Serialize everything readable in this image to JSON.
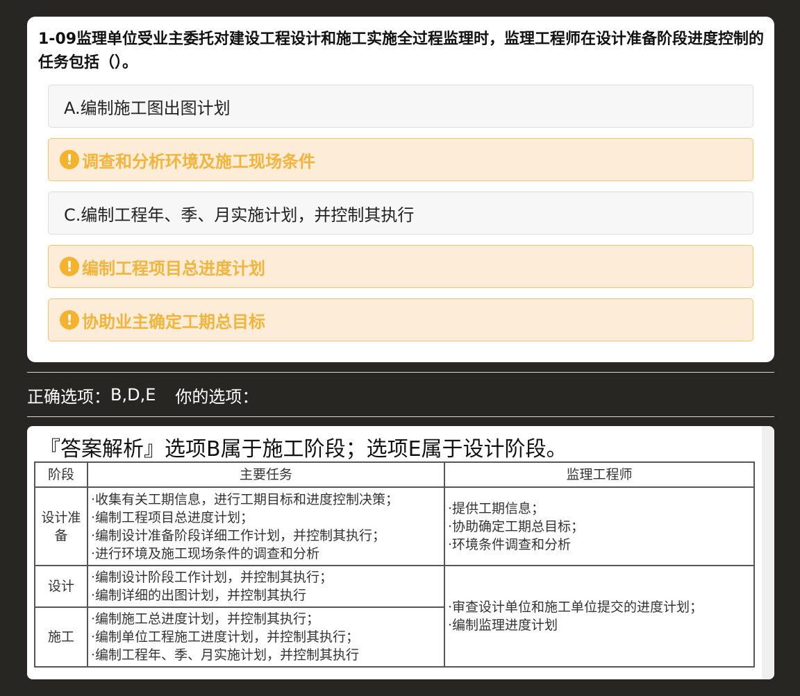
{
  "question": {
    "text": "1-09监理单位受业主委托对建设工程设计和施工实施全过程监理时，监理工程师在设计准备阶段进度控制的任务包括（）。",
    "options": [
      {
        "label": "A.编制施工图出图计划"
      },
      {
        "label": "调查和分析环境及施工现场条件",
        "icon": "exclamation-icon"
      },
      {
        "label": "C.编制工程年、季、月实施计划，并控制其执行"
      },
      {
        "label": "编制工程项目总进度计划",
        "icon": "exclamation-icon"
      },
      {
        "label": "协助业主确定工期总目标",
        "icon": "exclamation-icon"
      }
    ]
  },
  "answer": {
    "correct_label": "正确选项：",
    "correct_value": "B,D,E",
    "yours_label": "你的选项："
  },
  "analysis": {
    "title": "『答案解析』选项B属于施工阶段；选项E属于设计阶段。",
    "table": {
      "headers": [
        "阶段",
        "主要任务",
        "监理工程师"
      ],
      "rows": [
        {
          "stage": "设计准备",
          "tasks": [
            "·收集有关工期信息，进行工期目标和进度控制决策；",
            "·编制工程项目总进度计划；",
            "·编制设计准备阶段详细工作计划，并控制其执行；",
            "·进行环境及施工现场条件的调查和分析"
          ],
          "engineer": [
            "·提供工期信息；",
            "·协助确定工期总目标；",
            "·环境条件调查和分析"
          ]
        },
        {
          "stage": "设计",
          "tasks": [
            "·编制设计阶段工作计划，并控制其执行；",
            "·编制详细的出图计划，并控制其执行"
          ],
          "engineer": [
            "·审查设计单位和施工单位提交的进度计划；",
            "·编制监理进度计划"
          ]
        },
        {
          "stage": "施工",
          "tasks": [
            "·编制施工总进度计划，并控制其执行；",
            "·编制单位工程施工进度计划，并控制其执行；",
            "·编制工程年、季、月实施计划，并控制其执行"
          ]
        }
      ]
    }
  },
  "colors": {
    "background": "#272622",
    "flag_text": "#f2b43a",
    "flag_bg": "#fcecd8",
    "flag_border": "#f3c46a"
  }
}
